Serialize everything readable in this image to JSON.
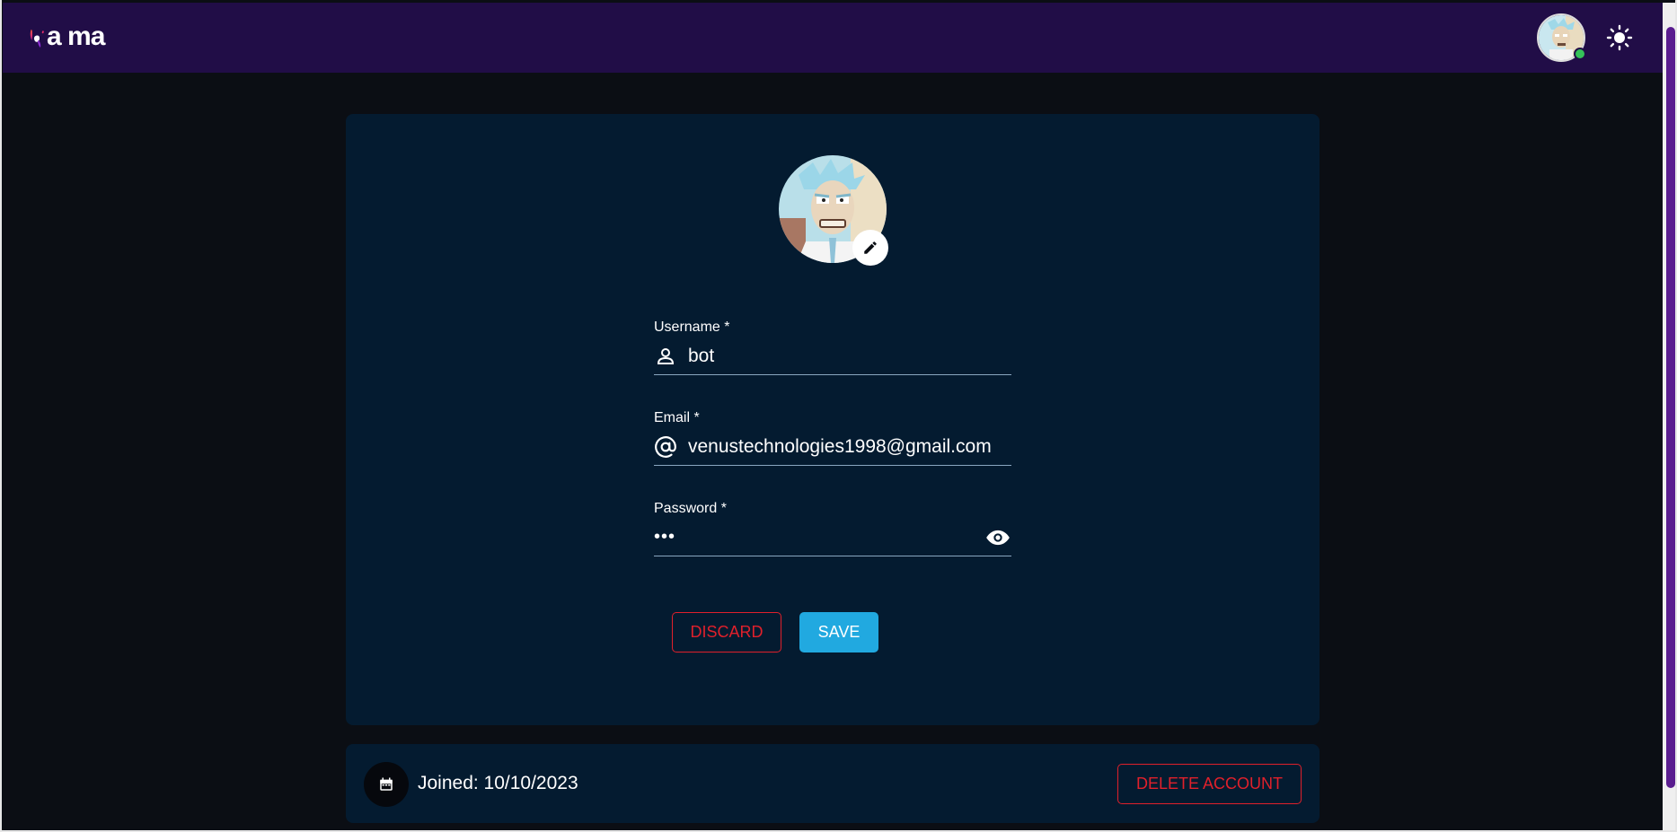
{
  "header": {
    "logo_text": "a ma",
    "avatar_alt": "user avatar",
    "theme_icon": "sun-icon"
  },
  "profile": {
    "avatar_icon": "avatar",
    "edit_icon": "pencil-icon",
    "fields": {
      "username": {
        "label": "Username *",
        "value": "bot",
        "icon": "person-icon"
      },
      "email": {
        "label": "Email *",
        "value": "venustechnologies1998@gmail.com",
        "icon": "at-sign-icon"
      },
      "password": {
        "label": "Password *",
        "value": "•••",
        "icon": "eye-icon"
      }
    },
    "buttons": {
      "discard": "DISCARD",
      "save": "SAVE"
    }
  },
  "footer": {
    "joined_text": "Joined: 10/10/2023",
    "calendar_icon": "calendar-icon",
    "delete_label": "DELETE ACCOUNT"
  },
  "colors": {
    "topbar": "#210d47",
    "background": "#0b0e14",
    "card": "#041b30",
    "danger": "#e0202b",
    "primary": "#21a9e0",
    "online": "#35c259"
  }
}
